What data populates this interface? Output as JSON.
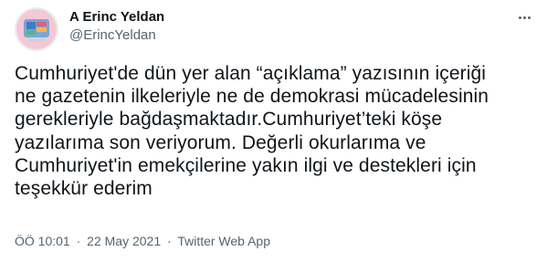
{
  "author": {
    "name": "A Erinc Yeldan",
    "handle": "@ErincYeldan"
  },
  "tweet": {
    "text": "Cumhuriyet'de dün yer alan “açıklama” yazısının içeriği\nne gazetenin ilkeleriyle ne de demokrasi mücadelesinin\ngerekleriyle bağdaşmaktadır.Cumhuriyet’teki köşe\nyazılarıma son veriyorum. Değerli okurlarıma ve\nCumhuriyet'in emekçilerine yakın ilgi ve destekleri için\nteşekkür ederim"
  },
  "meta": {
    "time": "ÖÖ 10:01",
    "separator": "·",
    "date": "22 May 2021",
    "source": "Twitter Web App"
  },
  "icons": {
    "more": "more-options-icon",
    "avatar": "avatar-image"
  },
  "colors": {
    "text_primary": "#0f1419",
    "text_secondary": "#536471",
    "background": "#ffffff"
  }
}
